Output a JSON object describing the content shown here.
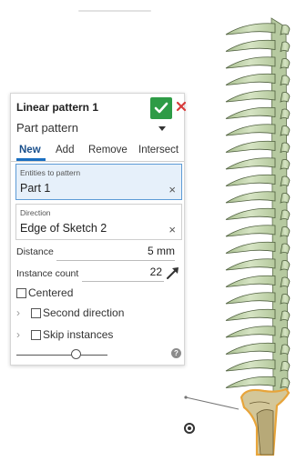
{
  "dialog": {
    "title": "Linear pattern 1",
    "pattern_type": "Part pattern",
    "tabs": [
      {
        "label": "New",
        "active": true
      },
      {
        "label": "Add",
        "active": false
      },
      {
        "label": "Remove",
        "active": false
      },
      {
        "label": "Intersect",
        "active": false
      }
    ],
    "entities": {
      "label": "Entities to pattern",
      "value": "Part 1",
      "clear": "×"
    },
    "direction": {
      "label": "Direction",
      "value": "Edge of Sketch 2",
      "clear": "×"
    },
    "distance": {
      "label": "Distance",
      "value": "5 mm"
    },
    "instance_count": {
      "label": "Instance count",
      "value": "22"
    },
    "centered": {
      "label": "Centered",
      "checked": false
    },
    "second_direction": {
      "label": "Second direction",
      "checked": false
    },
    "skip_instances": {
      "label": "Skip instances",
      "checked": false
    },
    "slider": {
      "value": 0.6
    },
    "help": "?"
  },
  "colors": {
    "accept": "#2e9b46",
    "cancel": "#d83b3b",
    "active_tab": "#1a6fc1",
    "part_fill": "#c9d9b4",
    "part_selected": "#e7a43a"
  },
  "icons": [
    "check-icon",
    "close-icon",
    "chevron-down-icon",
    "clear-icon",
    "direction-arrow-icon",
    "chevron-right-icon",
    "help-icon",
    "origin-icon"
  ]
}
